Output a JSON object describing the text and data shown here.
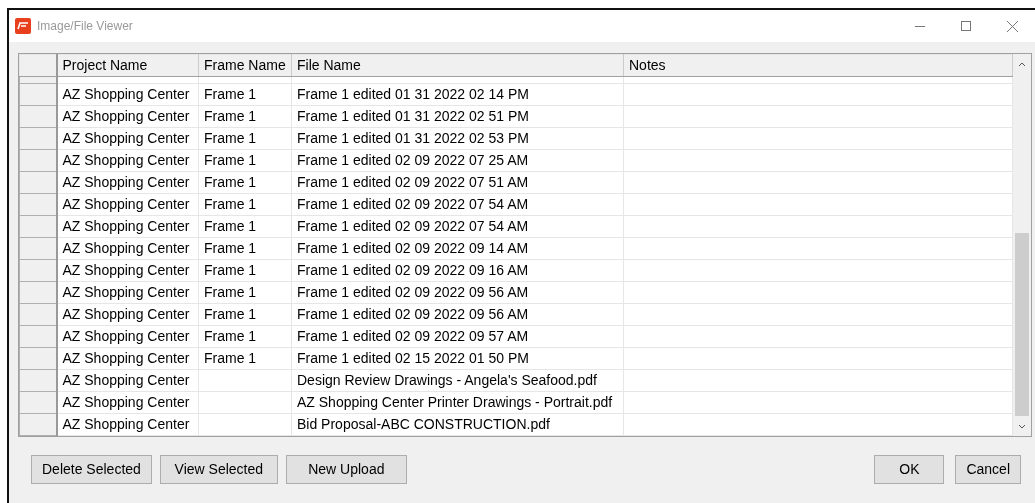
{
  "window": {
    "title": "Image/File Viewer"
  },
  "table": {
    "columns": [
      "Project Name",
      "Frame Name",
      "File Name",
      "Notes"
    ],
    "rows": [
      [
        "AZ Shopping Center",
        "Frame 1",
        "Frame 1 edited 01 31 2022 02 14 PM",
        ""
      ],
      [
        "AZ Shopping Center",
        "Frame 1",
        "Frame 1 edited 01 31 2022 02 51 PM",
        ""
      ],
      [
        "AZ Shopping Center",
        "Frame 1",
        "Frame 1 edited 01 31 2022 02 53 PM",
        ""
      ],
      [
        "AZ Shopping Center",
        "Frame 1",
        "Frame 1 edited 02 09 2022 07 25 AM",
        ""
      ],
      [
        "AZ Shopping Center",
        "Frame 1",
        "Frame 1 edited 02 09 2022 07 51 AM",
        ""
      ],
      [
        "AZ Shopping Center",
        "Frame 1",
        "Frame 1 edited 02 09 2022 07 54 AM",
        ""
      ],
      [
        "AZ Shopping Center",
        "Frame 1",
        "Frame 1 edited 02 09 2022 07 54 AM",
        ""
      ],
      [
        "AZ Shopping Center",
        "Frame 1",
        "Frame 1 edited 02 09 2022 09 14 AM",
        ""
      ],
      [
        "AZ Shopping Center",
        "Frame 1",
        "Frame 1 edited 02 09 2022 09 16 AM",
        ""
      ],
      [
        "AZ Shopping Center",
        "Frame 1",
        "Frame 1 edited 02 09 2022 09 56 AM",
        ""
      ],
      [
        "AZ Shopping Center",
        "Frame 1",
        "Frame 1 edited 02 09 2022 09 56 AM",
        ""
      ],
      [
        "AZ Shopping Center",
        "Frame 1",
        "Frame 1 edited 02 09 2022 09 57 AM",
        ""
      ],
      [
        "AZ Shopping Center",
        "Frame 1",
        "Frame 1 edited 02 15 2022 01 50 PM",
        ""
      ],
      [
        "AZ Shopping Center",
        "",
        "Design Review Drawings - Angela's Seafood.pdf",
        ""
      ],
      [
        "AZ Shopping Center",
        "",
        "AZ Shopping Center Printer Drawings - Portrait.pdf",
        ""
      ],
      [
        "AZ Shopping Center",
        "",
        "Bid Proposal-ABC CONSTRUCTION.pdf",
        ""
      ]
    ]
  },
  "left_buttons": [
    "Delete Selected",
    "View Selected",
    "New Upload"
  ],
  "right_buttons": [
    "OK",
    "Cancel"
  ]
}
